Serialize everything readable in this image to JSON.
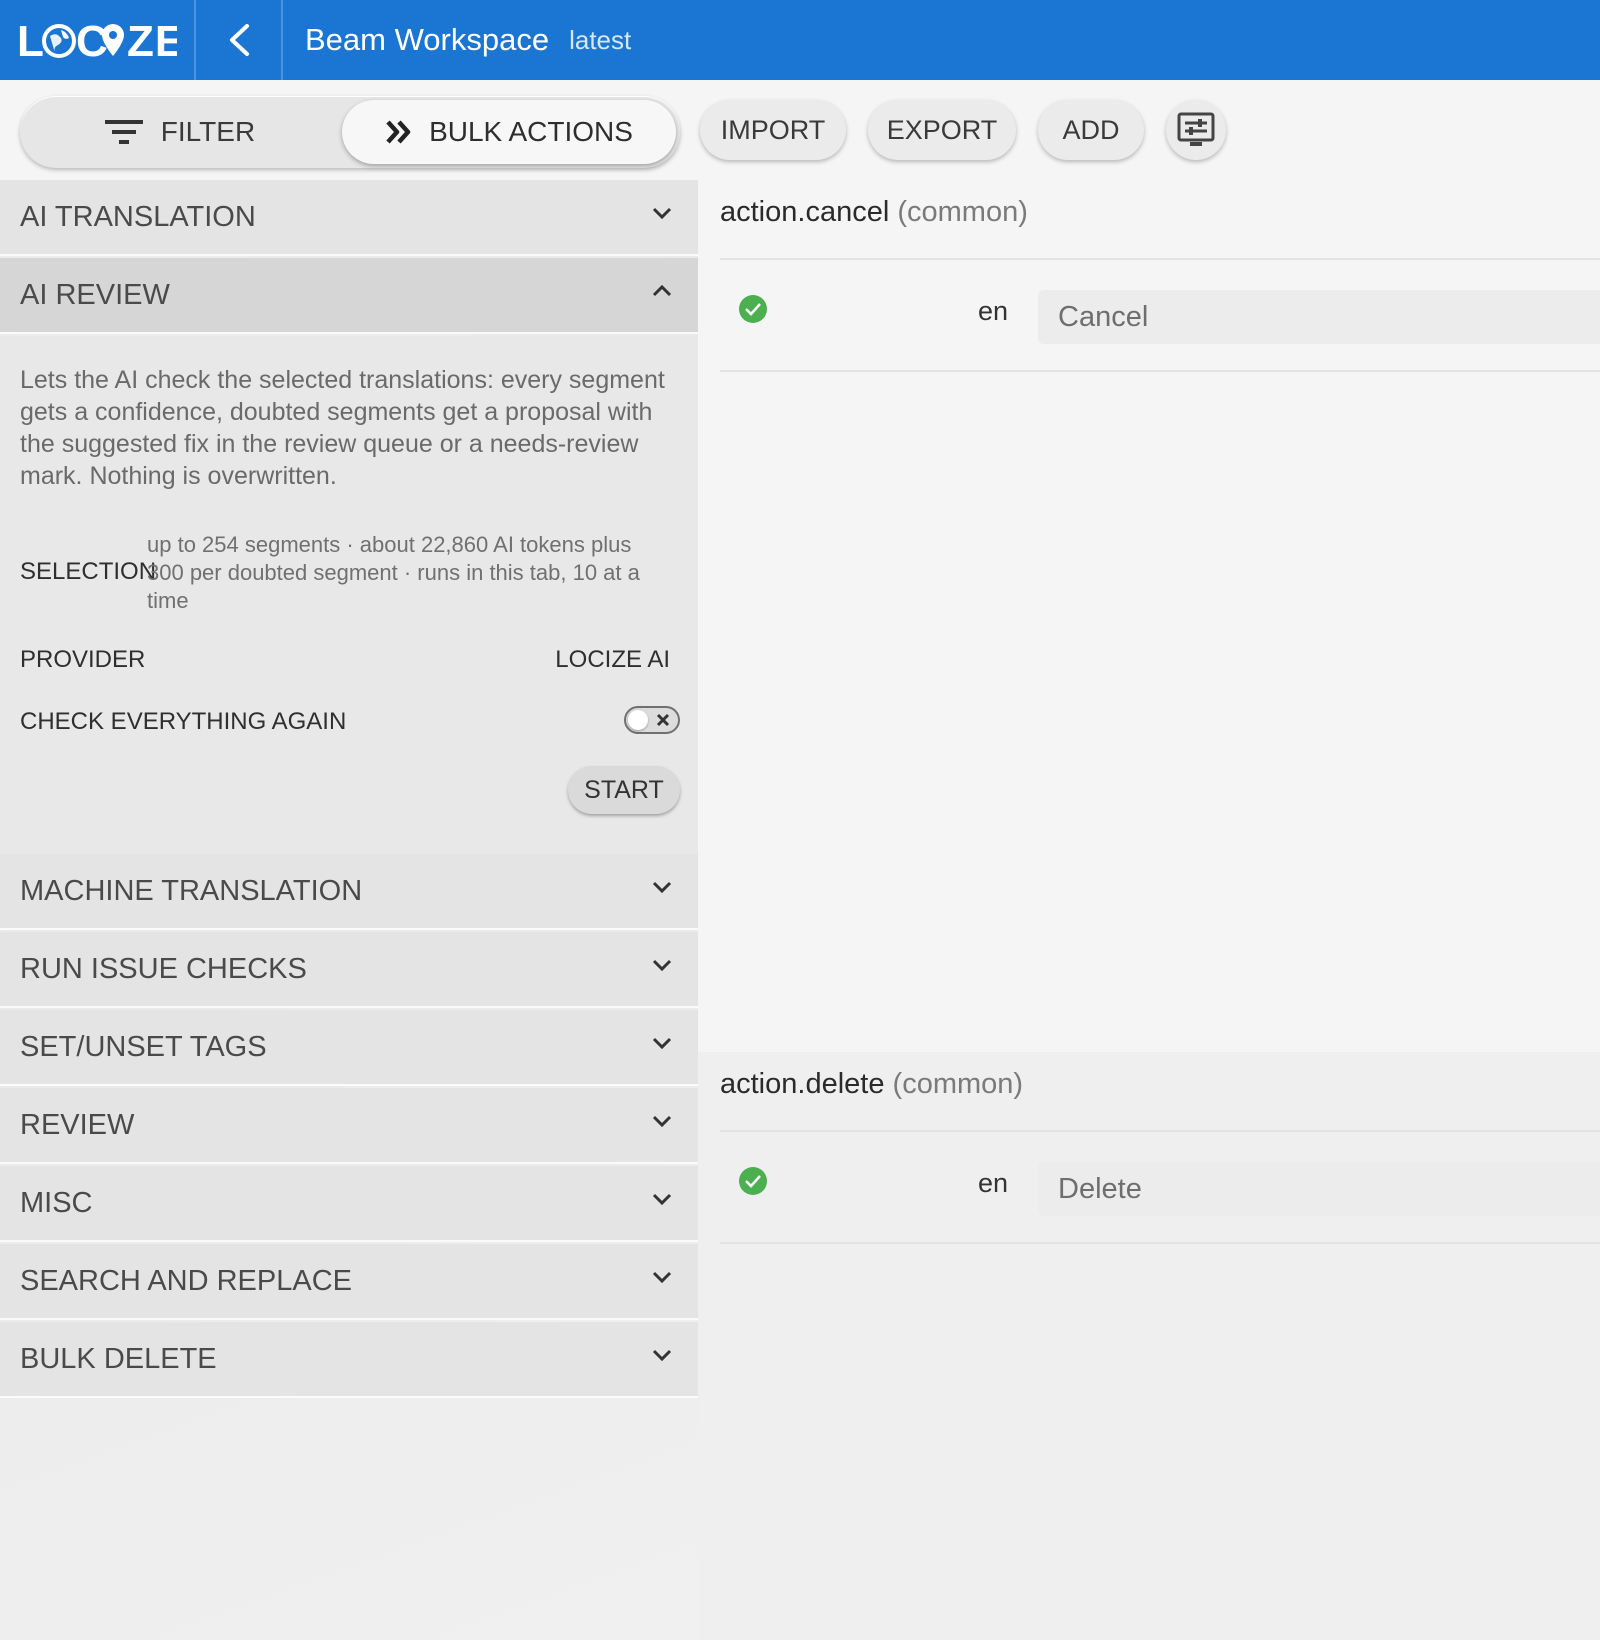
{
  "header": {
    "logo_text": "LOCIZE",
    "project_name": "Beam Workspace",
    "version": "latest",
    "colors": {
      "bar": "#1b76d3",
      "text": "#ffffff"
    }
  },
  "toolbar": {
    "filter_label": "FILTER",
    "bulk_actions_label": "BULK ACTIONS",
    "import_label": "IMPORT",
    "export_label": "EXPORT",
    "add_label": "ADD",
    "layout_icon": "display-settings-icon"
  },
  "sidebar": {
    "sections": [
      {
        "label": "AI TRANSLATION",
        "expanded": false
      },
      {
        "label": "AI REVIEW",
        "expanded": true
      },
      {
        "label": "MACHINE TRANSLATION",
        "expanded": false
      },
      {
        "label": "RUN ISSUE CHECKS",
        "expanded": false
      },
      {
        "label": "SET/UNSET TAGS",
        "expanded": false
      },
      {
        "label": "REVIEW",
        "expanded": false
      },
      {
        "label": "MISC",
        "expanded": false
      },
      {
        "label": "SEARCH AND REPLACE",
        "expanded": false
      },
      {
        "label": "BULK DELETE",
        "expanded": false
      }
    ],
    "ai_review": {
      "description": "Lets the AI check the selected translations: every segment gets a confidence, doubted segments get a proposal with the suggested fix in the review queue or a needs-review mark. Nothing is overwritten.",
      "selection_label": "SELECTION",
      "selection_text": "up to 254 segments · about 22,860 AI tokens plus 300 per doubted segment · runs in this tab, 10 at a time",
      "provider_label": "PROVIDER",
      "provider_value": "LOCIZE AI",
      "check_again_label": "CHECK EVERYTHING AGAIN",
      "check_again_on": false,
      "start_label": "START"
    }
  },
  "main": {
    "keys": [
      {
        "key": "action.cancel",
        "namespace": "(common)",
        "lang": "en",
        "value": "Cancel",
        "status": "ok"
      },
      {
        "key": "action.delete",
        "namespace": "(common)",
        "lang": "en",
        "value": "Delete",
        "status": "ok"
      }
    ],
    "status_color": "#4caf50"
  }
}
